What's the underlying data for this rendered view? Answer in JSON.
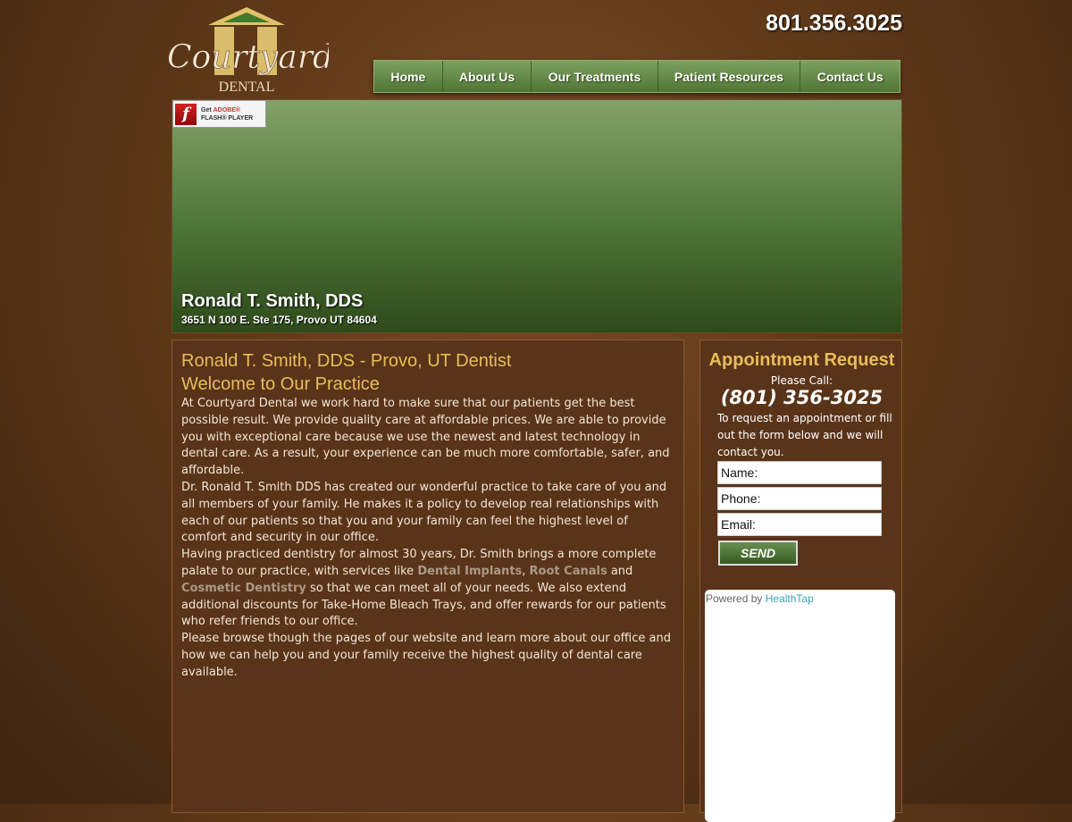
{
  "header": {
    "logo_text": "Courtyard DENTAL",
    "phone": "801.356.3025"
  },
  "nav": [
    {
      "label": "Home"
    },
    {
      "label": "About Us"
    },
    {
      "label": "Our Treatments"
    },
    {
      "label": "Patient Resources"
    },
    {
      "label": "Contact Us"
    }
  ],
  "banner": {
    "flash_line1_prefix": "Get ",
    "flash_line1_brand": "ADOBE®",
    "flash_line2": "FLASH® PLAYER",
    "name": "Ronald T. Smith, DDS",
    "address": "3651 N 100 E. Ste 175, Provo UT 84604"
  },
  "main": {
    "title": "Ronald T. Smith, DDS - Provo, UT Dentist",
    "subtitle": "Welcome to Our Practice",
    "p1": "At Courtyard Dental we work hard to make sure that our patients get the best possible result. We provide quality care at affordable prices. We are able to provide you with exceptional care because we use the newest and latest technology in dental care. As a result, your experience can be much more comfortable, safer, and affordable.",
    "p2": "Dr. Ronald T. Smith DDS has created our wonderful practice to take care of you and all members of your family. He makes it a policy to develop real relationships with each of our patients so that you and your family can feel the highest level of comfort and security in our office.",
    "p3": {
      "a": "Having practiced dentistry for almost 30 years, Dr. Smith brings a more complete palate to our practice, with services like ",
      "link1": "Dental Implants",
      "b": ", ",
      "link2": "Root Canals",
      "c": " and ",
      "link3": "Cosmetic Dentistry",
      "d": " so that we can meet all of your needs. We also extend additional discounts for Take-Home Bleach Trays, and offer rewards for our patients who refer friends to our office."
    },
    "p4": "Please browse though the pages of our website and learn more about our office and how we can help you and your family receive the highest quality of dental care available."
  },
  "sidebar": {
    "title": "Appointment Request",
    "please_call": "Please Call:",
    "phone": "(801) 356-3025",
    "request_text": "To request an appointment or fill out the form below and we will contact you.",
    "name_placeholder": "Name:",
    "phone_placeholder": "Phone:",
    "email_placeholder": "Email:",
    "send": "SEND",
    "powered_by": "Powered by ",
    "healthtap": "HealthTap"
  }
}
